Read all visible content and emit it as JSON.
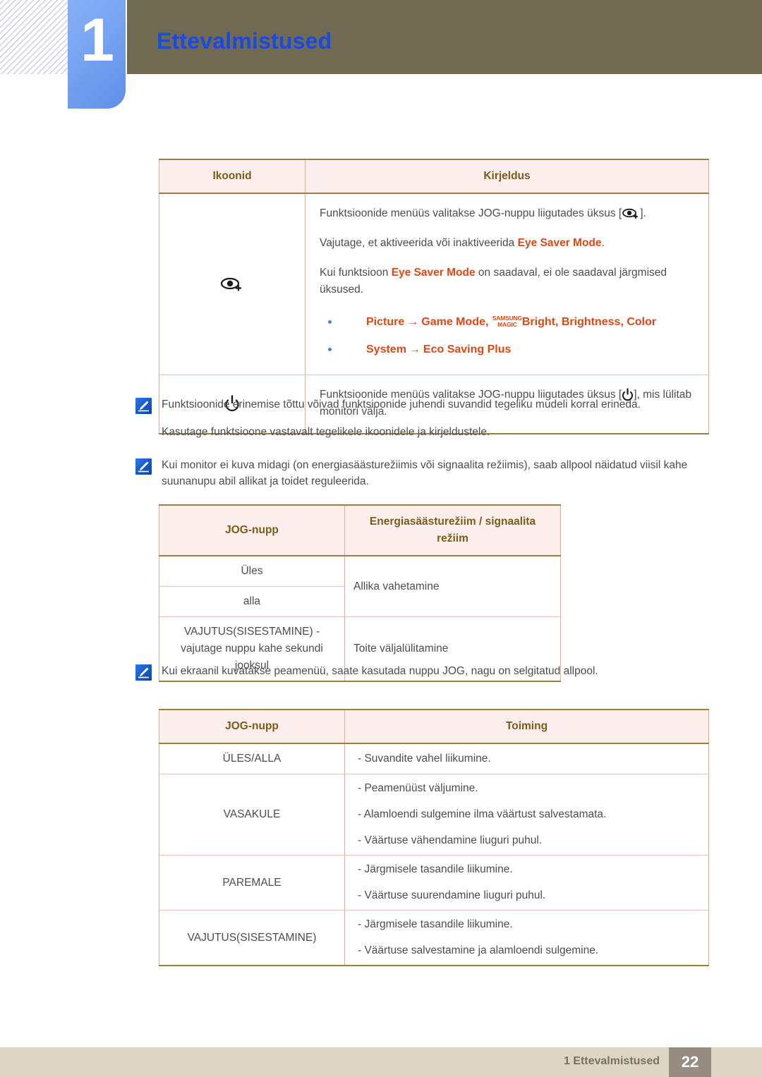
{
  "header": {
    "chapter_number": "1",
    "chapter_title": "Ettevalmistused"
  },
  "colors": {
    "accent_blue": "#1a4be0",
    "tab_blue": "#7aa6f3",
    "topbar_olive": "#6f6a51",
    "table_header_bg": "#fbeeec",
    "table_header_text": "#7a5c19",
    "table_border_strong": "#9c7f3f",
    "table_border_light": "#e8a98e",
    "highlight_orange": "#dd4814",
    "bullet_blue": "#4a7fd6",
    "footer_bg": "#dcd6c4",
    "footer_page_bg": "#968d80"
  },
  "table_icons": {
    "headers": [
      "Ikoonid",
      "Kirjeldus"
    ],
    "rows": [
      {
        "icon": "eye-plus-icon",
        "paragraphs": [
          {
            "prefix": "Funktsioonide menüüs valitakse JOG-nuppu liigutades üksus [",
            "inline_icon": "eye-plus-icon",
            "suffix": "]."
          },
          {
            "prefix": "Vajutage, et aktiveerida või inaktiveerida ",
            "highlight": "Eye Saver Mode",
            "suffix": "."
          },
          {
            "prefix": "Kui funktsioon ",
            "highlight": "Eye Saver Mode",
            "suffix": " on saadaval, ei ole saadaval järgmised üksused."
          }
        ],
        "bullets": [
          {
            "parts": [
              "Picture",
              "Game Mode,",
              "Bright,",
              "Brightness,",
              "Color"
            ],
            "item1": "Picture",
            "arrow": "→",
            "item2": "Game Mode",
            "magic_top": "SAMSUNG",
            "magic_bottom": "MAGIC",
            "item3": "Bright",
            "item4": "Brightness",
            "item5": "Color",
            "text_after_magic": "Bright, Brightness, Color"
          },
          {
            "item1": "System",
            "arrow": "→",
            "item2": "Eco Saving Plus"
          }
        ]
      },
      {
        "icon": "power-icon",
        "paragraphs": [
          {
            "prefix": "Funktsioonide menüüs valitakse JOG-nuppu liigutades üksus [",
            "inline_icon": "power-icon",
            "suffix": "], mis lülitab monitori välja."
          }
        ]
      }
    ]
  },
  "notes": [
    {
      "icon": "note-pen-icon",
      "lines": [
        "Funktsioonide erinemise tõttu võivad funktsioonide juhendi suvandid tegeliku mudeli korral erineda.",
        "Kasutage funktsioone vastavalt tegelikele ikoonidele ja kirjeldustele."
      ]
    },
    {
      "icon": "note-pen-icon",
      "lines": [
        "Kui monitor ei kuva midagi (on energiasäästurežiimis või signaalita režiimis), saab allpool näidatud viisil kahe suunanupu abil allikat ja toidet reguleerida."
      ]
    },
    {
      "icon": "note-pen-icon",
      "lines": [
        "Kui ekraanil kuvatakse peamenüü, saate kasutada nuppu JOG, nagu on selgitatud allpool."
      ]
    }
  ],
  "table_power": {
    "headers": [
      "JOG-nupp",
      "Energiasäästurežiim / signaalita režiim"
    ],
    "header_line1": "Energiasäästurežiim / signaalita",
    "header_line2": "režiim",
    "rows": [
      {
        "button": "Üles",
        "action": "Allika vahetamine"
      },
      {
        "button": "alla",
        "action": ""
      },
      {
        "button": "VAJUTUS(SISESTAMINE) - vajutage nuppu kahe sekundi jooksul",
        "action": "Toite väljalülitamine"
      }
    ]
  },
  "table_jog": {
    "headers": [
      "JOG-nupp",
      "Toiming"
    ],
    "rows": [
      {
        "button": "ÜLES/ALLA",
        "actions": [
          "- Suvandite vahel liikumine."
        ]
      },
      {
        "button": "VASAKULE",
        "actions": [
          "- Peamenüüst väljumine.",
          "- Alamloendi sulgemine ilma väärtust salvestamata.",
          "- Väärtuse vähendamine liuguri puhul."
        ]
      },
      {
        "button": "PAREMALE",
        "actions": [
          "- Järgmisele tasandile liikumine.",
          "- Väärtuse suurendamine liuguri puhul."
        ]
      },
      {
        "button": "VAJUTUS(SISESTAMINE)",
        "actions": [
          "- Järgmisele tasandile liikumine.",
          "- Väärtuse salvestamine ja alamloendi sulgemine."
        ]
      }
    ]
  },
  "footer": {
    "label": "1 Ettevalmistused",
    "page_number": "22"
  }
}
